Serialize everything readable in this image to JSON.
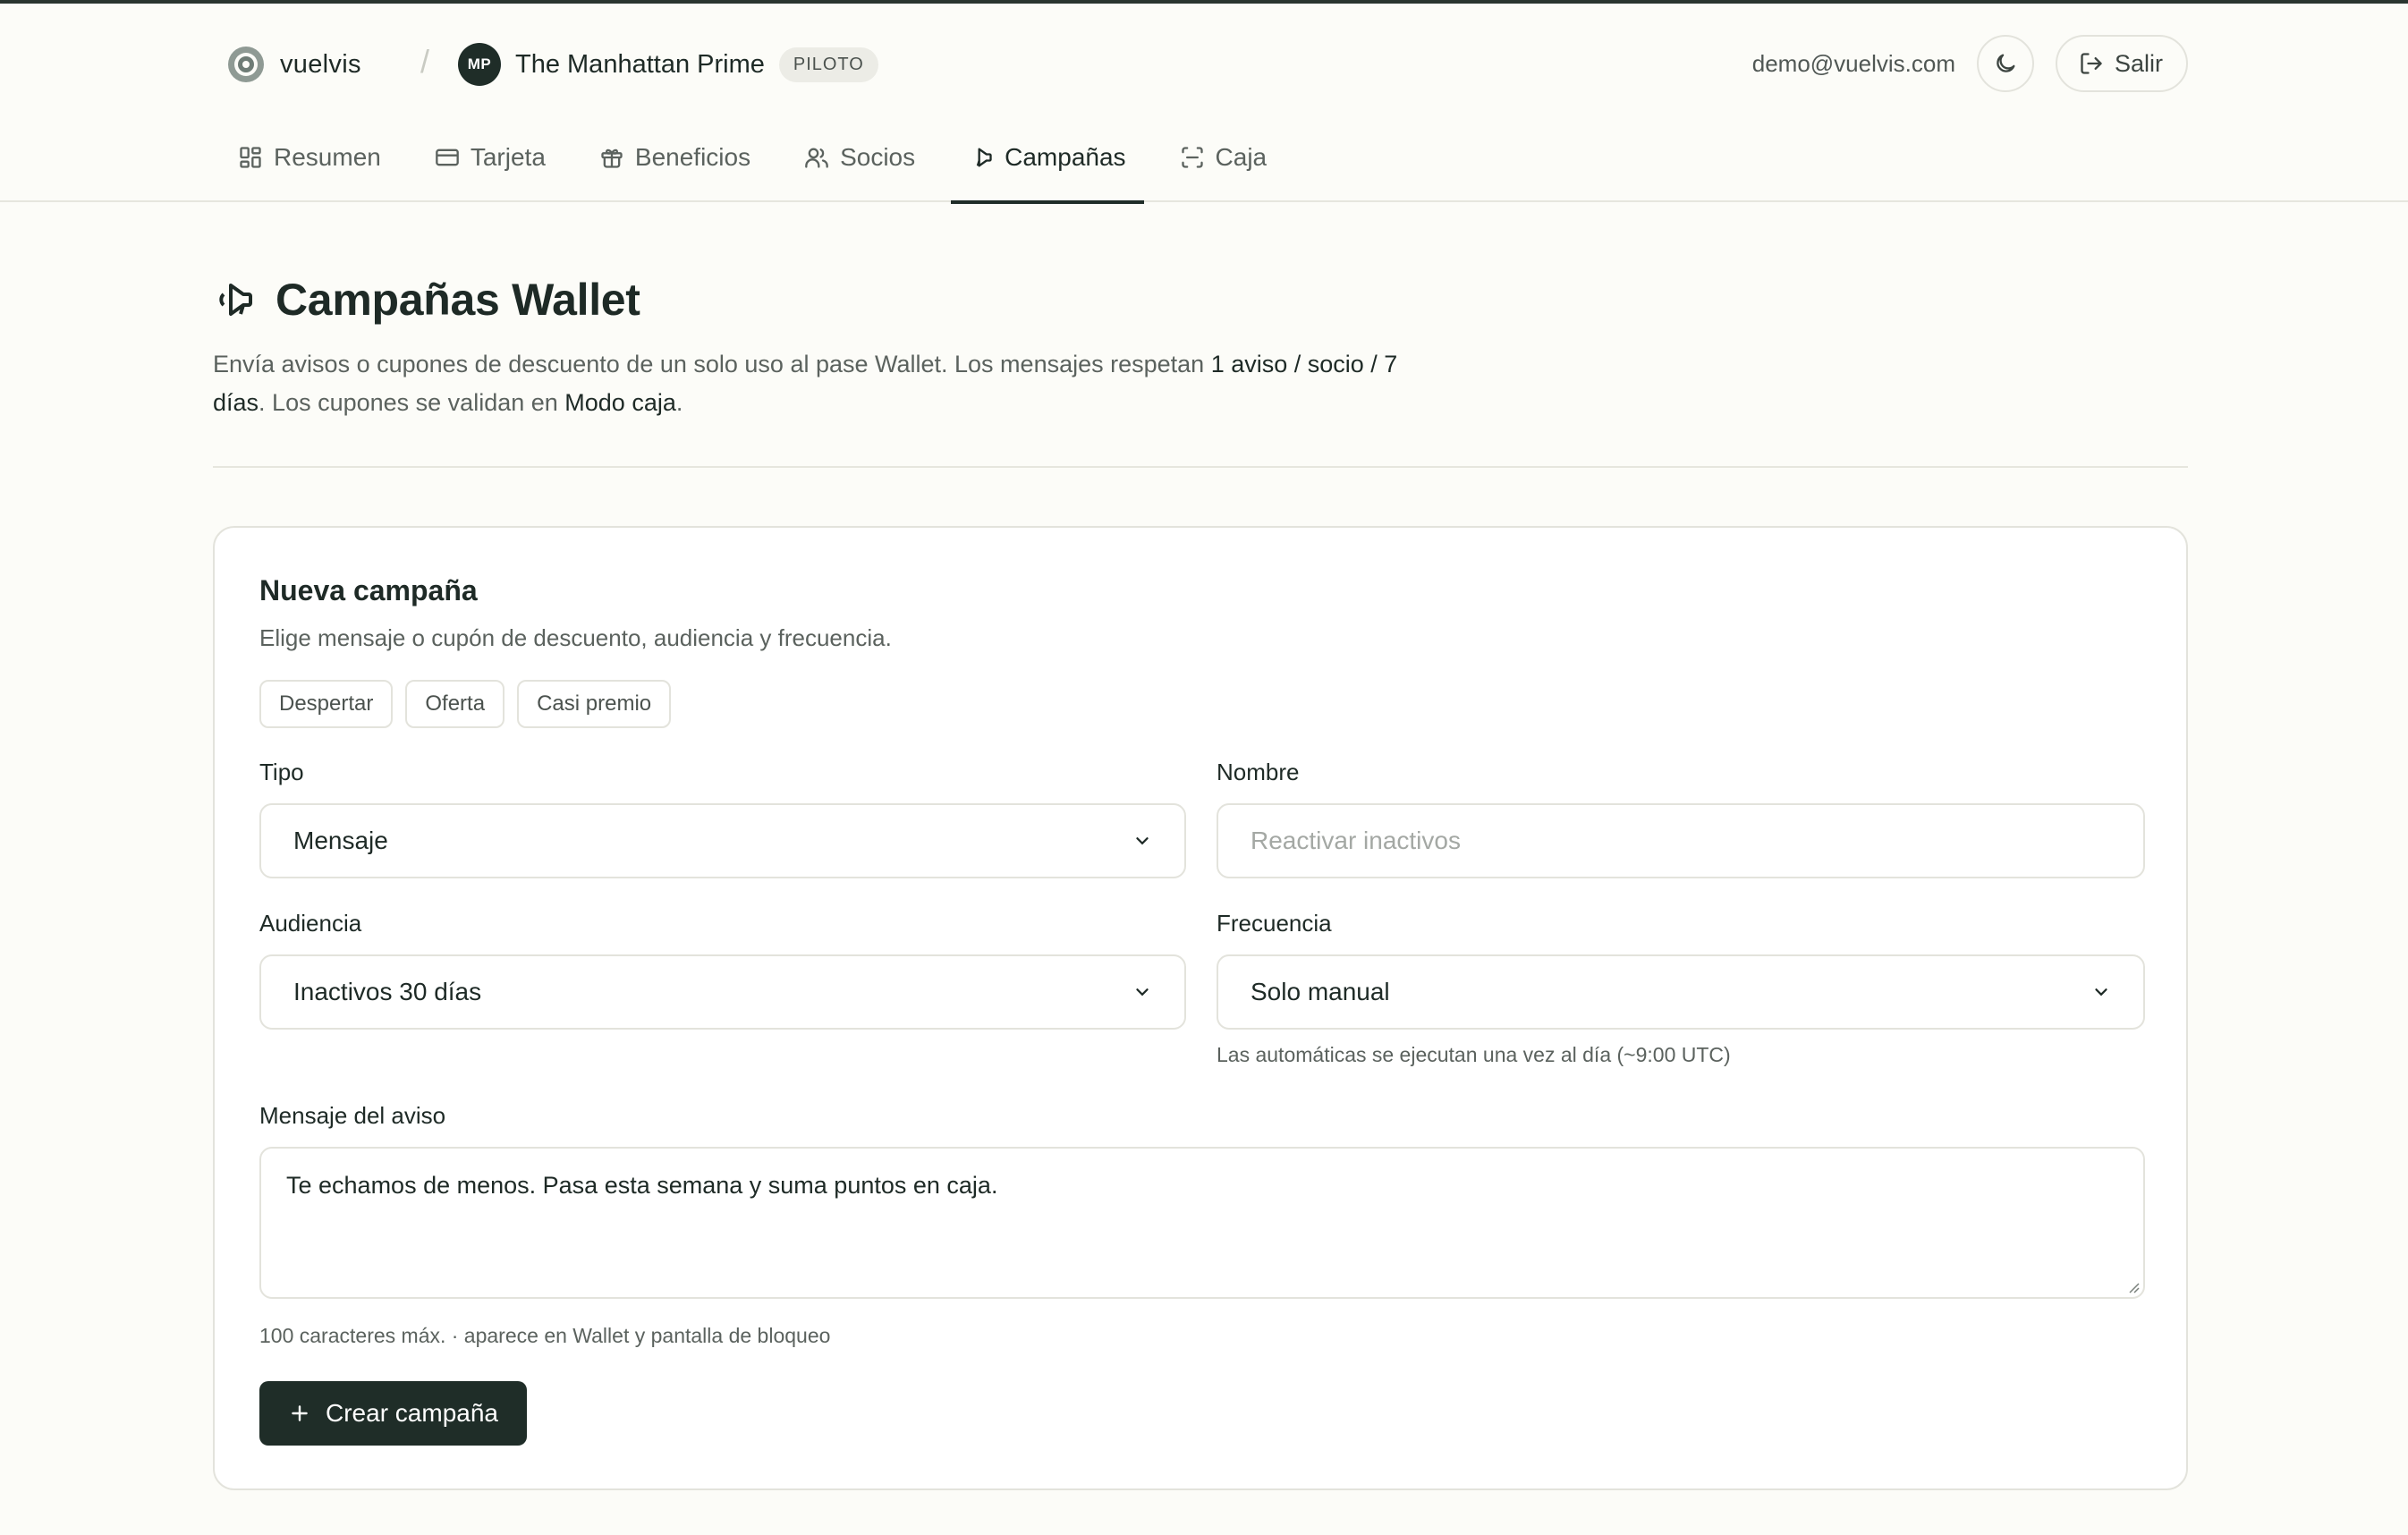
{
  "brand": {
    "name": "vuelvis"
  },
  "business": {
    "initials": "MP",
    "name": "The Manhattan Prime",
    "badge": "PILOTO"
  },
  "user": {
    "email": "demo@vuelvis.com",
    "logout_label": "Salir"
  },
  "tabs": [
    {
      "label": "Resumen",
      "icon": "grid-icon"
    },
    {
      "label": "Tarjeta",
      "icon": "card-icon"
    },
    {
      "label": "Beneficios",
      "icon": "gift-icon"
    },
    {
      "label": "Socios",
      "icon": "users-icon"
    },
    {
      "label": "Campañas",
      "icon": "megaphone-icon",
      "active": true
    },
    {
      "label": "Caja",
      "icon": "scan-icon"
    }
  ],
  "page": {
    "title": "Campañas Wallet",
    "intro_1": "Envía avisos o cupones de descuento de un solo uso al pase Wallet. Los mensajes respetan ",
    "intro_bold_1": "1 aviso / socio / 7 días",
    "intro_2": ". Los cupones se validan en ",
    "intro_bold_2": "Modo caja",
    "intro_3": "."
  },
  "form": {
    "title": "Nueva campaña",
    "subtitle": "Elige mensaje o cupón de descuento, audiencia y frecuencia.",
    "templates": [
      "Despertar",
      "Oferta",
      "Casi premio"
    ],
    "type_label": "Tipo",
    "type_value": "Mensaje",
    "name_label": "Nombre",
    "name_placeholder": "Reactivar inactivos",
    "audience_label": "Audiencia",
    "audience_value": "Inactivos 30 días",
    "frequency_label": "Frecuencia",
    "frequency_value": "Solo manual",
    "frequency_hint": "Las automáticas se ejecutan una vez al día (~9:00 UTC)",
    "message_label": "Mensaje del aviso",
    "message_value": "Te echamos de menos. Pasa esta semana y suma puntos en caja.",
    "message_hint": "100 caracteres máx. · aparece en Wallet y pantalla de bloqueo",
    "submit_label": "Crear campaña"
  },
  "colors": {
    "accent": "#1f2d28",
    "background": "#fcfcf8",
    "border": "#e3e3dc"
  }
}
